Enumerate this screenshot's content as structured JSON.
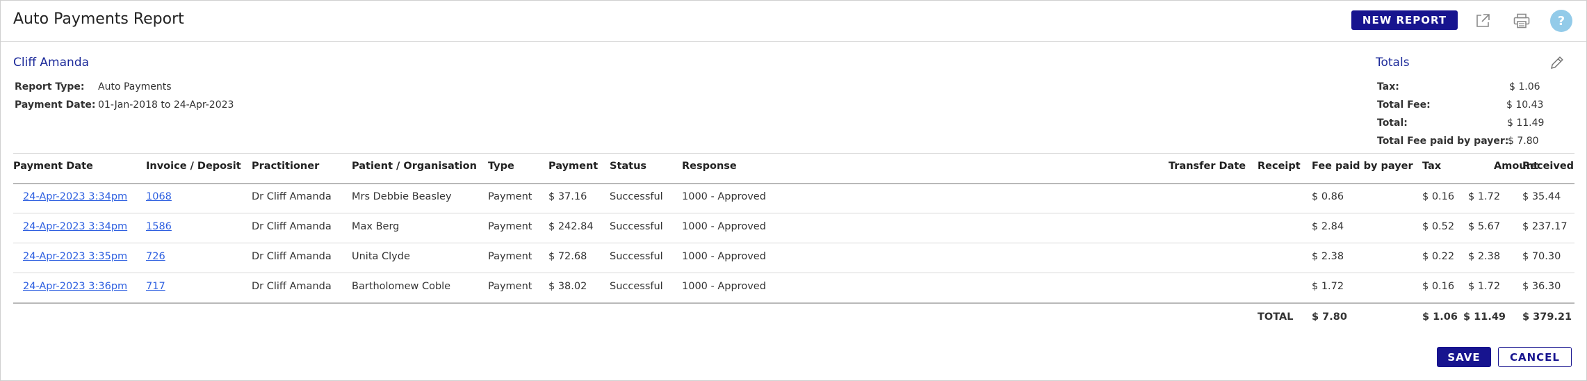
{
  "header": {
    "title": "Auto Payments Report",
    "new_report_label": "NEW REPORT",
    "help_label": "?"
  },
  "report": {
    "name": "Cliff Amanda",
    "report_type_label": "Report Type:",
    "report_type_value": "Auto Payments",
    "payment_date_label": "Payment Date:",
    "payment_date_value": "01-Jan-2018 to 24-Apr-2023"
  },
  "totals": {
    "title": "Totals",
    "rows": [
      {
        "label": "Tax:",
        "value": "$ 1.06"
      },
      {
        "label": "Total Fee:",
        "value": "$ 10.43"
      },
      {
        "label": "Total:",
        "value": "$ 11.49"
      },
      {
        "label": "Total Fee paid by payer:",
        "value": "$ 7.80"
      }
    ]
  },
  "table": {
    "headers": {
      "payment_date": "Payment Date",
      "invoice": "Invoice / Deposit",
      "practitioner": "Practitioner",
      "patient": "Patient / Organisation",
      "type": "Type",
      "payment": "Payment",
      "status": "Status",
      "response": "Response",
      "transfer_date": "Transfer Date",
      "receipt": "Receipt",
      "fee": "Fee paid by payer",
      "tax": "Tax",
      "amount": "Amount",
      "received": "Received"
    },
    "rows": [
      {
        "payment_date": "24-Apr-2023 3:34pm",
        "invoice": "1068",
        "practitioner": "Dr Cliff Amanda",
        "patient": "Mrs Debbie Beasley",
        "type": "Payment",
        "payment": "$ 37.16",
        "status": "Successful",
        "response": "1000 - Approved",
        "transfer_date": "",
        "receipt": "",
        "fee": "$ 0.86",
        "tax": "$ 0.16",
        "amount": "$ 1.72",
        "received": "$ 35.44"
      },
      {
        "payment_date": "24-Apr-2023 3:34pm",
        "invoice": "1586",
        "practitioner": "Dr Cliff Amanda",
        "patient": "Max Berg",
        "type": "Payment",
        "payment": "$ 242.84",
        "status": "Successful",
        "response": "1000 - Approved",
        "transfer_date": "",
        "receipt": "",
        "fee": "$ 2.84",
        "tax": "$ 0.52",
        "amount": "$ 5.67",
        "received": "$ 237.17"
      },
      {
        "payment_date": "24-Apr-2023 3:35pm",
        "invoice": "726",
        "practitioner": "Dr Cliff Amanda",
        "patient": "Unita Clyde",
        "type": "Payment",
        "payment": "$ 72.68",
        "status": "Successful",
        "response": "1000 - Approved",
        "transfer_date": "",
        "receipt": "",
        "fee": "$ 2.38",
        "tax": "$ 0.22",
        "amount": "$ 2.38",
        "received": "$ 70.30"
      },
      {
        "payment_date": "24-Apr-2023 3:36pm",
        "invoice": "717",
        "practitioner": "Dr Cliff Amanda",
        "patient": "Bartholomew Coble",
        "type": "Payment",
        "payment": "$ 38.02",
        "status": "Successful",
        "response": "1000 - Approved",
        "transfer_date": "",
        "receipt": "",
        "fee": "$ 1.72",
        "tax": "$ 0.16",
        "amount": "$ 1.72",
        "received": "$ 36.30"
      }
    ],
    "footer": {
      "label": "TOTAL",
      "fee": "$ 7.80",
      "tax": "$ 1.06",
      "amount": "$ 11.49",
      "received": "$ 379.21"
    }
  },
  "actions": {
    "save_label": "SAVE",
    "cancel_label": "CANCEL"
  },
  "icons": {
    "export": "external-link-icon",
    "print": "printer-icon",
    "help": "help-icon",
    "edit": "pencil-icon"
  },
  "colors": {
    "primary": "#17148f",
    "link": "#2d5fe0",
    "heading": "#1c2a9a",
    "help": "#93cbe9"
  }
}
